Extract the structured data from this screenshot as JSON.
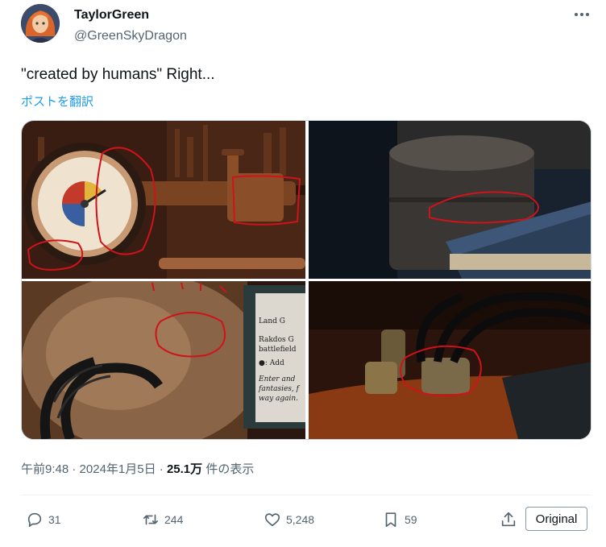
{
  "author": {
    "display_name": "TaylorGreen",
    "handle": "@GreenSkyDragon"
  },
  "tweet": {
    "text": "\"created by humans\" Right...",
    "translate_label": "ポストを翻訳"
  },
  "meta": {
    "time": "午前9:48",
    "separator1": " · ",
    "date": "2024年1月5日",
    "separator2": " · ",
    "views_count": "25.1万",
    "views_label": " 件の表示"
  },
  "actions": {
    "replies": "31",
    "reposts": "244",
    "likes": "5,248",
    "bookmarks": "59",
    "original_label": "Original"
  },
  "colors": {
    "link": "#1d9bf0",
    "secondary_text": "#536471",
    "annotation_red": "#d0121a"
  },
  "media": {
    "image3_card_lines": [
      "Land  G",
      "Rakdos G",
      "battlefield",
      "●: Add",
      "Enter and",
      "fantasies, f",
      "way again."
    ]
  }
}
